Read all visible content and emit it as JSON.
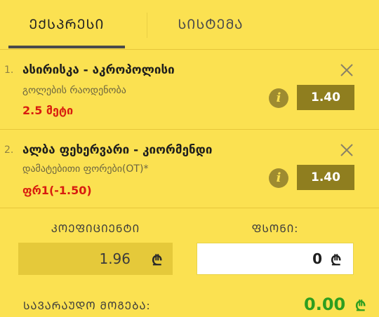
{
  "tabs": {
    "express": "ᲔᲥᲡᲞᲠᲔᲡᲘ",
    "system": "ᲡᲘᲡᲢᲔᲛᲐ"
  },
  "bets": [
    {
      "number": "1.",
      "title": "ასირისკა - აკროპოლისი",
      "market": "გოლების რაოდენობა",
      "pick": "2.5 მეტი",
      "odd": "1.40"
    },
    {
      "number": "2.",
      "title": "ალბა ფეხერვარი - კიორმენდი",
      "market": "დამატებითი ფორები(OT)*",
      "pick": "ფრ1(-1.50)",
      "odd": "1.40"
    }
  ],
  "slip": {
    "coefficient_label": "ᲙᲝᲔᲤᲘᲪᲘᲔᲜᲢᲘ",
    "coefficient_value": "1.96",
    "stake_label": "ᲤᲡᲝᲜᲘ:",
    "stake_value": "0",
    "currency": "₾",
    "potential_win_label": "ᲡᲐᲕᲐᲠᲐᲣᲓᲝ ᲛᲝᲒᲔᲑᲐ:",
    "potential_win_value": "0.00"
  },
  "colors": {
    "background": "#fbe151",
    "odd_button": "#8f7e1f",
    "pick_text": "#d81c0f",
    "win_text": "#2e9e1f"
  },
  "icons": {
    "close": "close-icon",
    "info": "info-icon",
    "currency": "lari-icon"
  }
}
